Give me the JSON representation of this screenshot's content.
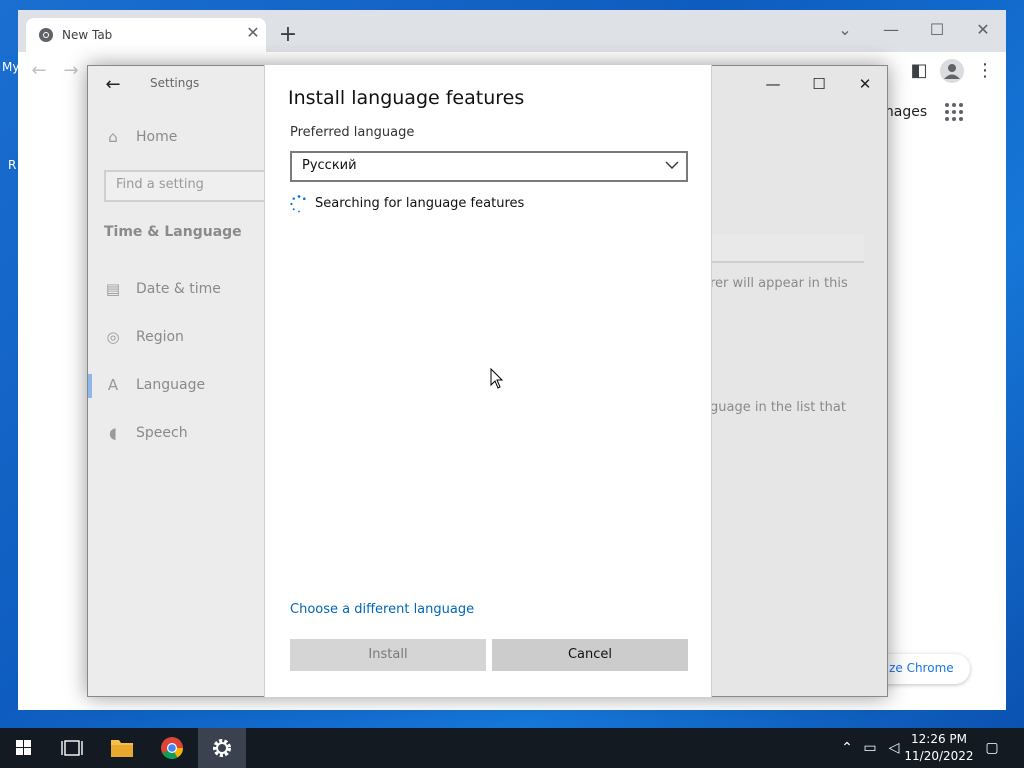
{
  "desktop": {
    "icon_fragment_1": "My",
    "icon_fragment_2": "R"
  },
  "chrome": {
    "tab_title": "New Tab",
    "tab_close": "✕",
    "new_tab": "+",
    "images_link": "Images",
    "customize_label": "tomize Chrome"
  },
  "settings": {
    "title": "Settings",
    "back_glyph": "←",
    "home": "Home",
    "search_placeholder": "Find a setting",
    "section": "Time & Language",
    "items": [
      {
        "label": "Date & time",
        "icon": "calendar-clock-icon"
      },
      {
        "label": "Region",
        "icon": "globe-icon"
      },
      {
        "label": "Language",
        "icon": "language-icon"
      },
      {
        "label": "Speech",
        "icon": "microphone-icon"
      }
    ],
    "bg_text_1": "rer will appear in this",
    "bg_text_2": "guage in the list that"
  },
  "dialog": {
    "title": "Install language features",
    "preferred_label": "Preferred language",
    "selected_language": "Русский",
    "status": "Searching for language features",
    "choose_link": "Choose a different language",
    "install_button": "Install",
    "cancel_button": "Cancel"
  },
  "taskbar": {
    "time": "12:26 PM",
    "date": "11/20/2022"
  },
  "colors": {
    "accent": "#0067b8",
    "chrome_link": "#1a73e8",
    "taskbar": "#141a22"
  }
}
